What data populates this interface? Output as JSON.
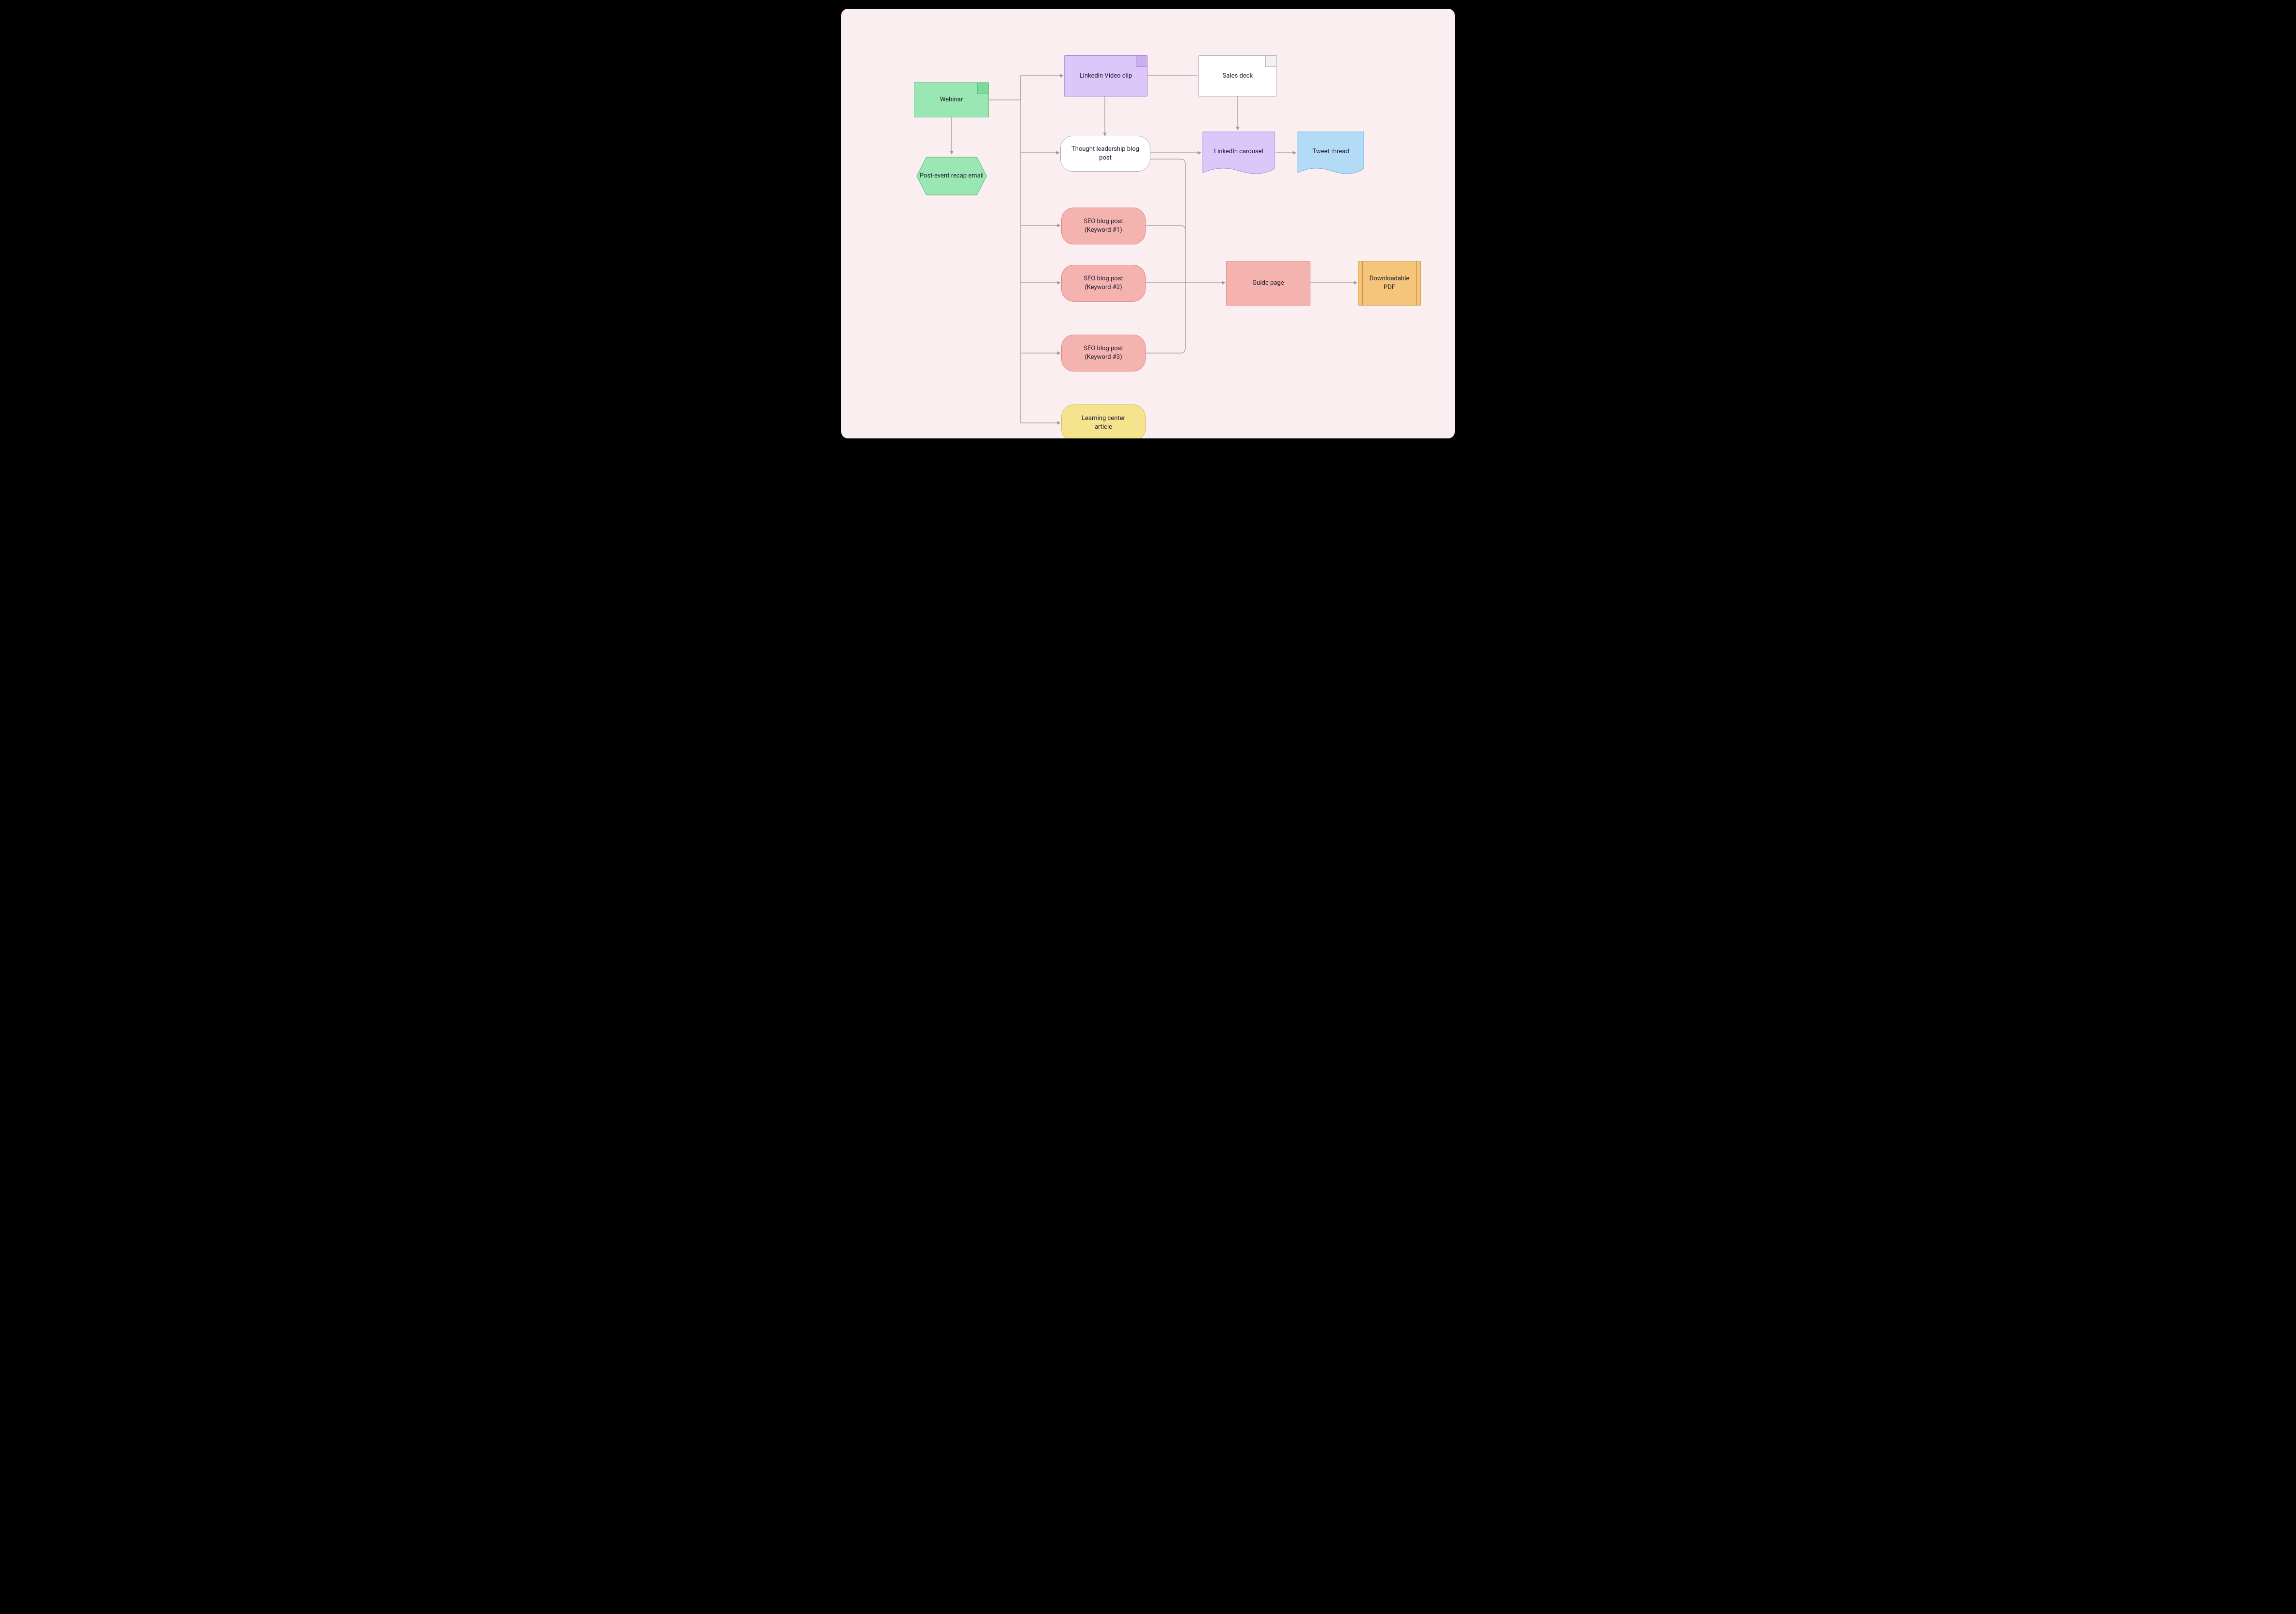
{
  "nodes": {
    "webinar": "Webinar",
    "recap": "Post-event recap email",
    "liVideo": "Linkedin Video clip",
    "salesDeck": "Sales deck",
    "thought": "Thought leadership blog post",
    "liCarousel": "LinkedIn carousel",
    "tweet": "Tweet thread",
    "seo1a": "SEO blog post",
    "seo1b": "(Keyword #1)",
    "seo2a": "SEO blog post",
    "seo2b": "(Keyword #2)",
    "seo3a": "SEO blog post",
    "seo3b": "(Keyword #3)",
    "guide": "Guide page",
    "pdf": "Downloadable PDF",
    "learnA": "Learning center",
    "learnB": "article"
  },
  "colors": {
    "greenFill": "#9be7b3",
    "greenStroke": "#49b973",
    "purpleFill": "#dcc8f8",
    "purpleStroke": "#ad85e0",
    "whiteFill": "#ffffff",
    "grayStroke": "#b7b7b7",
    "pinkFill": "#f5b3b0",
    "pinkStroke": "#e08481",
    "blueFill": "#b4dbf6",
    "blueStroke": "#6fb4e5",
    "yellowFill": "#f6e38e",
    "yellowStroke": "#d8bd51",
    "orangeFill": "#f4c57a",
    "orangeStroke": "#c89339",
    "connector": "#9a9a9a"
  }
}
